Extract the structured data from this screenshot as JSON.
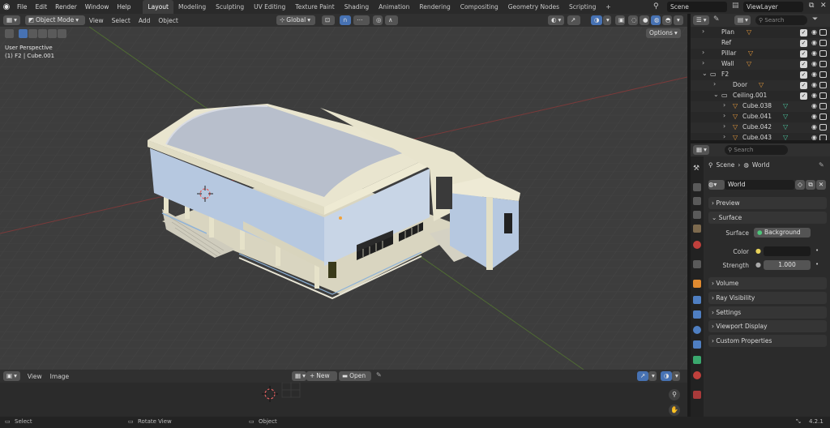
{
  "topbar": {
    "menus": [
      "File",
      "Edit",
      "Render",
      "Window",
      "Help"
    ],
    "workspaces": [
      "Layout",
      "Modeling",
      "Sculpting",
      "UV Editing",
      "Texture Paint",
      "Shading",
      "Animation",
      "Rendering",
      "Compositing",
      "Geometry Nodes",
      "Scripting"
    ],
    "active_workspace": "Layout",
    "scene": "Scene",
    "view_layer": "ViewLayer"
  },
  "viewport_header": {
    "mode": "Object Mode",
    "menus": [
      "View",
      "Select",
      "Add",
      "Object"
    ],
    "orientation": "Global"
  },
  "viewport": {
    "perspective_label": "User Perspective",
    "object_label": "(1) F2 | Cube.001",
    "options_label": "Options"
  },
  "image_editor": {
    "menus": [
      "View",
      "Image"
    ],
    "new_label": "New",
    "open_label": "Open"
  },
  "status": {
    "select": "Select",
    "rotate": "Rotate View",
    "object": "Object",
    "version": "4.2.1"
  },
  "outliner": {
    "search_placeholder": "Search",
    "rows": [
      {
        "label": "Plan"
      },
      {
        "label": "Ref"
      },
      {
        "label": "Pillar"
      },
      {
        "label": "Wall"
      },
      {
        "label": "F2"
      },
      {
        "label": "Door"
      },
      {
        "label": "Ceiling.001"
      },
      {
        "label": "Cube.038"
      },
      {
        "label": "Cube.041"
      },
      {
        "label": "Cube.042"
      },
      {
        "label": "Cube.043"
      }
    ]
  },
  "properties": {
    "search_placeholder": "Search",
    "breadcrumb_scene": "Scene",
    "breadcrumb_world": "World",
    "world_name": "World",
    "panels": {
      "preview": "Preview",
      "surface": "Surface",
      "volume": "Volume",
      "ray_visibility": "Ray Visibility",
      "settings": "Settings",
      "viewport_display": "Viewport Display",
      "custom_properties": "Custom Properties"
    },
    "surface_label": "Surface",
    "surface_value": "Background",
    "color_label": "Color",
    "strength_label": "Strength",
    "strength_value": "1.000"
  },
  "colors": {
    "accent": "#4772b3",
    "viewport_bg": "#3d3d3d",
    "building_wall": "#e8e4c6",
    "building_glass": "#b6c8e0"
  }
}
